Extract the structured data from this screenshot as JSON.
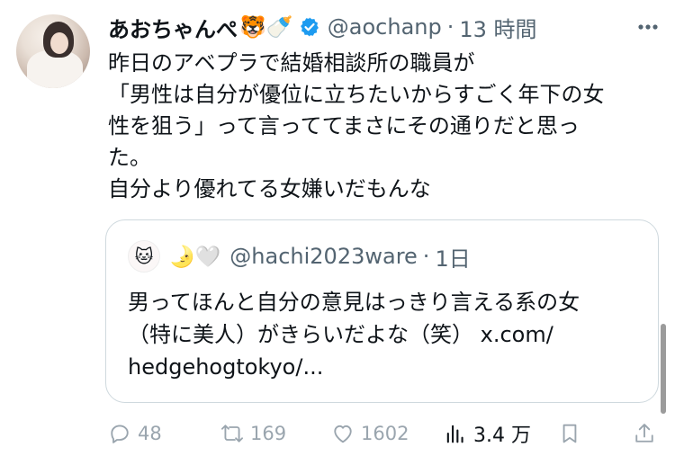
{
  "tweet": {
    "author_name": "あおちゃんぺ",
    "author_emojis": "🐯🍼",
    "handle": "@aochanp",
    "separator": "·",
    "time": "13 時間",
    "text_lines": [
      "昨日のアベプラで結婚相談所の職員が",
      "「男性は自分が優位に立ちたいからすごく年下の女",
      "性を狙う」って言っててまさにその通りだと思っ",
      "た。",
      "自分より優れてる女嫌いだもんな"
    ]
  },
  "quote": {
    "avatar_emoji": "🐱",
    "emojis": "🌛🤍",
    "handle": "@hachi2023ware",
    "separator": "·",
    "time": "1日",
    "text_lines": [
      "男ってほんと自分の意見はっきり言える系の女",
      "（特に美人）がきらいだよな（笑） x.com/",
      "hedgehogtokyo/..."
    ]
  },
  "actions": {
    "replies": "48",
    "retweets": "169",
    "likes": "1602",
    "views": "3.4 万"
  },
  "colors": {
    "text": "#0f1419",
    "muted": "#536471",
    "verified": "#1d9bf0",
    "border": "#cfd9de"
  }
}
